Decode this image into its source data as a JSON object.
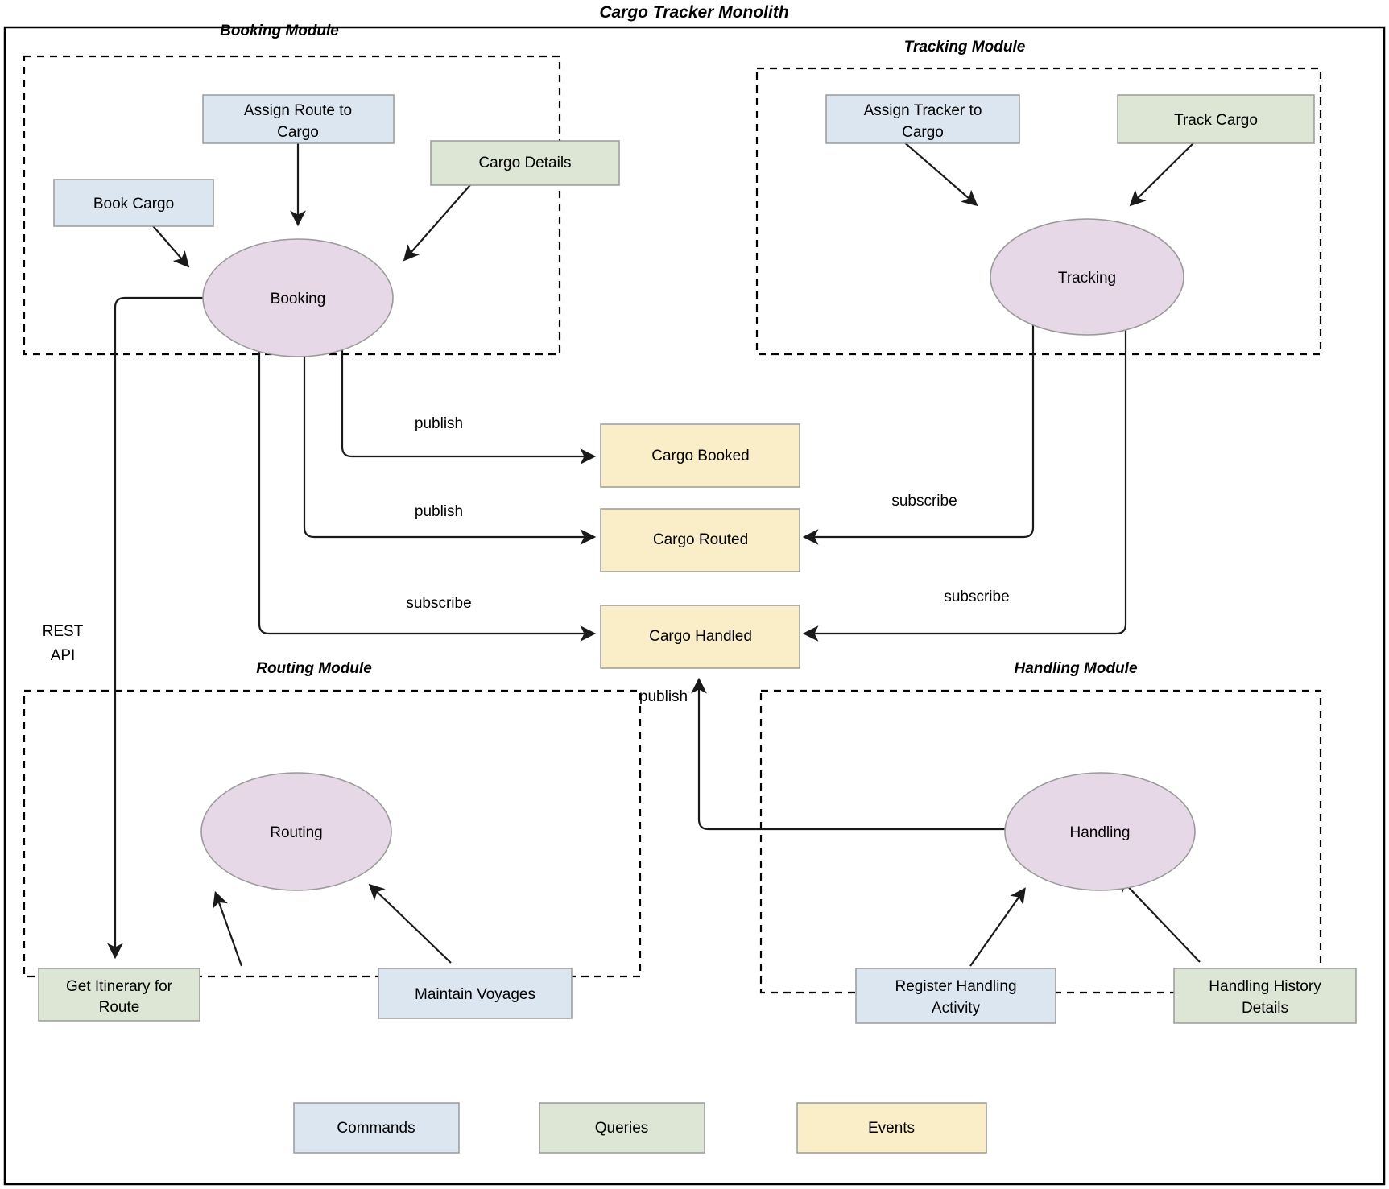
{
  "diagram": {
    "title": "Cargo  Tracker Monolith",
    "modules": [
      {
        "id": "booking",
        "title": "Booking Module"
      },
      {
        "id": "tracking",
        "title": "Tracking Module"
      },
      {
        "id": "routing",
        "title": "Routing Module"
      },
      {
        "id": "handling",
        "title": "Handling Module"
      }
    ],
    "nodes": [
      {
        "id": "booking-node",
        "label": "Booking"
      },
      {
        "id": "tracking-node",
        "label": "Tracking"
      },
      {
        "id": "routing-node",
        "label": "Routing"
      },
      {
        "id": "handling-node",
        "label": "Handling"
      }
    ],
    "boxes": [
      {
        "id": "book-cargo",
        "kind": "command",
        "line1": "Book Cargo",
        "line2": ""
      },
      {
        "id": "assign-route-to-cargo",
        "kind": "command",
        "line1": "Assign Route to",
        "line2": "Cargo"
      },
      {
        "id": "cargo-details",
        "kind": "query",
        "line1": "Cargo Details",
        "line2": ""
      },
      {
        "id": "assign-tracker-to-cargo",
        "kind": "command",
        "line1": "Assign Tracker to",
        "line2": "Cargo"
      },
      {
        "id": "track-cargo",
        "kind": "query",
        "line1": "Track Cargo",
        "line2": ""
      },
      {
        "id": "cargo-booked",
        "kind": "event",
        "line1": "Cargo Booked",
        "line2": ""
      },
      {
        "id": "cargo-routed",
        "kind": "event",
        "line1": "Cargo Routed",
        "line2": ""
      },
      {
        "id": "cargo-handled",
        "kind": "event",
        "line1": "Cargo Handled",
        "line2": ""
      },
      {
        "id": "get-itinerary-for-route",
        "kind": "query",
        "line1": "Get Itinerary for",
        "line2": "Route"
      },
      {
        "id": "maintain-voyages",
        "kind": "command",
        "line1": "Maintain Voyages",
        "line2": ""
      },
      {
        "id": "register-handling-activity",
        "kind": "command",
        "line1": "Register Handling",
        "line2": "Activity"
      },
      {
        "id": "handling-history-details",
        "kind": "query",
        "line1": "Handling History",
        "line2": "Details"
      }
    ],
    "edge_labels": {
      "publish_booked": "publish",
      "publish_routed": "publish",
      "subscribe_booking_handled": "subscribe",
      "subscribe_tracking_routed": "subscribe",
      "subscribe_tracking_handled": "subscribe",
      "publish_handling_handled": "publish",
      "rest_api_line1": "REST",
      "rest_api_line2": "API"
    },
    "legend": [
      {
        "id": "legend-commands",
        "kind": "command",
        "label": "Commands"
      },
      {
        "id": "legend-queries",
        "kind": "query",
        "label": "Queries"
      },
      {
        "id": "legend-events",
        "kind": "event",
        "label": "Events"
      }
    ],
    "colors": {
      "command_fill": "#dce6f1",
      "query_fill": "#dde5d5",
      "event_fill": "#faeec8",
      "node_fill": "#e7d8e8",
      "stroke": "#1a1a1a"
    }
  }
}
